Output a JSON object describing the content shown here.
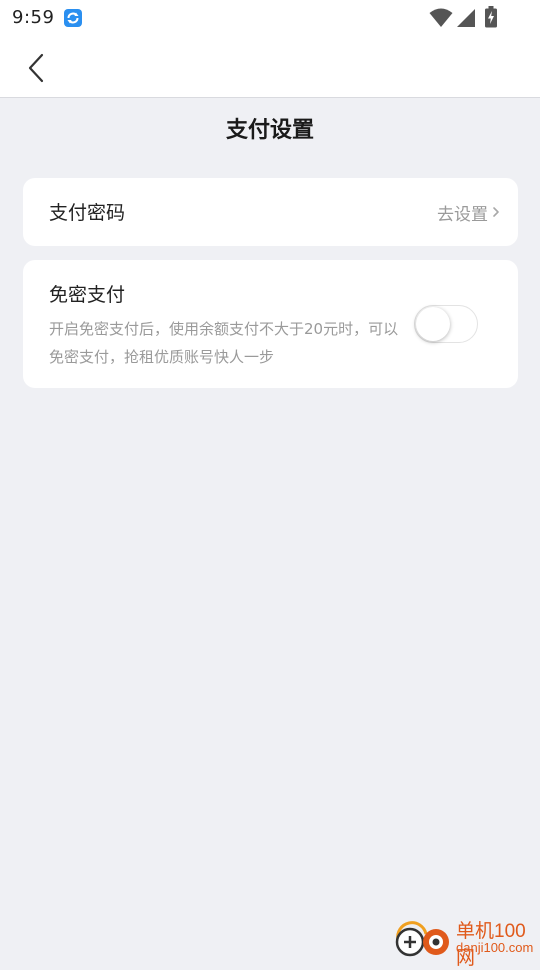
{
  "status_bar": {
    "time": "9:59",
    "notification_icon": "app-notification-icon",
    "wifi_icon": "wifi-icon",
    "signal_icon": "signal-icon",
    "battery_icon": "battery-charging-icon"
  },
  "nav": {
    "back_icon": "chevron-left-icon"
  },
  "page": {
    "title": "支付设置"
  },
  "payment_password": {
    "label": "支付密码",
    "action": "去设置",
    "chevron_icon": "chevron-right-icon"
  },
  "password_free": {
    "label": "免密支付",
    "description": "开启免密支付后，使用余额支付不大于20元时，可以免密支付，抢租优质账号快人一步",
    "enabled": false
  },
  "watermark": {
    "name": "单机100网",
    "url": "danji100.com"
  },
  "colors": {
    "background": "#eff0f4",
    "card": "#ffffff",
    "secondary_text": "#9a9a9a",
    "watermark": "#e05a1b"
  }
}
